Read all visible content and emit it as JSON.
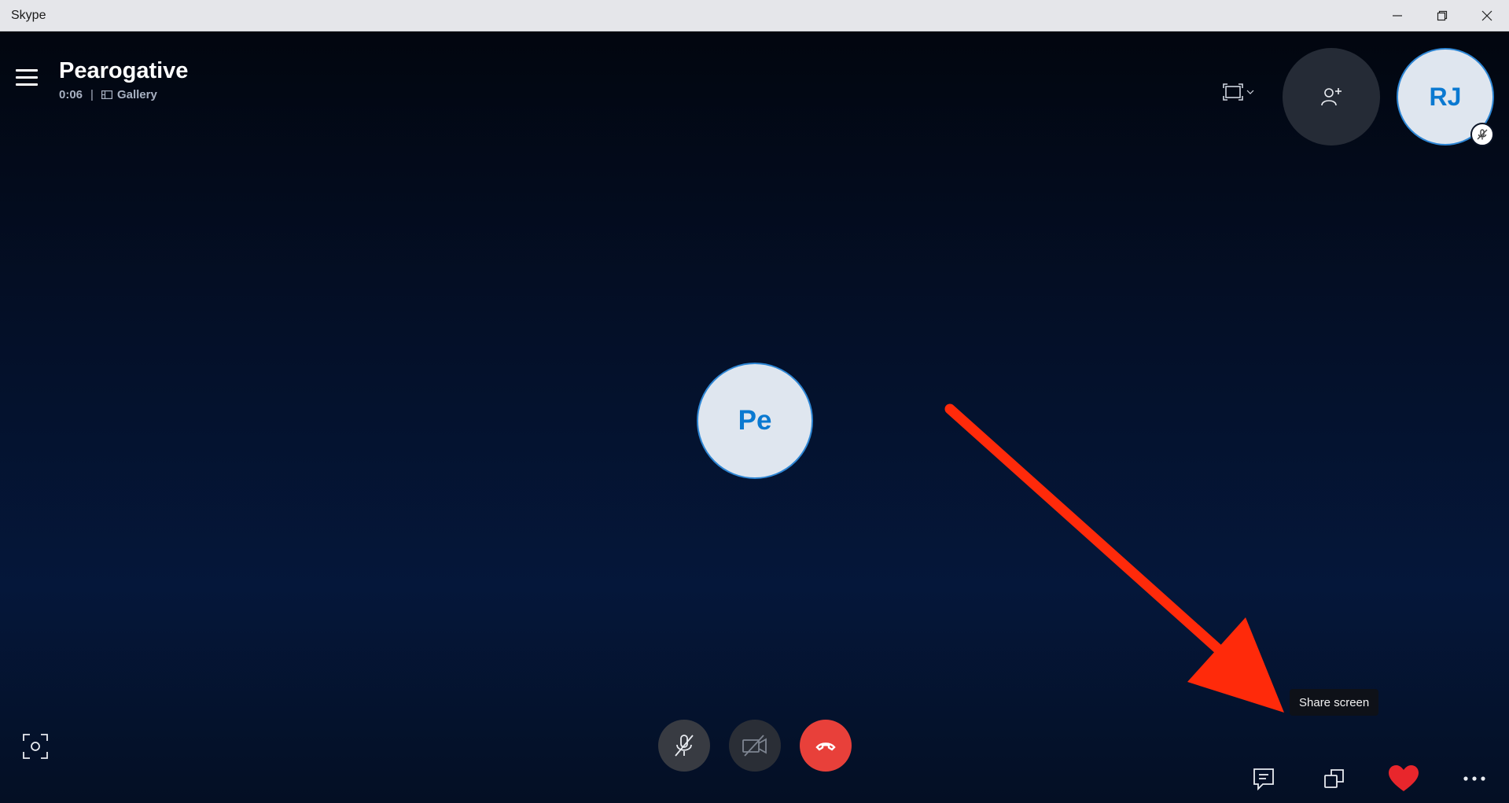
{
  "window": {
    "title": "Skype",
    "controls": [
      "minimize-icon",
      "restore-icon",
      "close-icon"
    ]
  },
  "call": {
    "name": "Pearogative",
    "duration": "0:06",
    "separator": "|",
    "view_mode": "Gallery"
  },
  "participants": {
    "self_initials": "RJ",
    "self_muted": true,
    "remote_initials": "Pe"
  },
  "tooltip": {
    "text": "Share screen"
  },
  "controls": {
    "mic": {
      "icon": "mic-off-icon",
      "state": "muted"
    },
    "camera": {
      "icon": "video-off-icon",
      "state": "off"
    },
    "end_call": {
      "icon": "hang-up-icon"
    },
    "right": [
      "chat-icon",
      "share-screen-icon",
      "heart-icon",
      "more-icon"
    ]
  },
  "colors": {
    "end_call": "#e8403a",
    "avatar_text": "#0a79d1",
    "avatar_ring": "#2e86d4",
    "annotation_arrow": "#ff2a0a",
    "heart": "#e8262c"
  }
}
